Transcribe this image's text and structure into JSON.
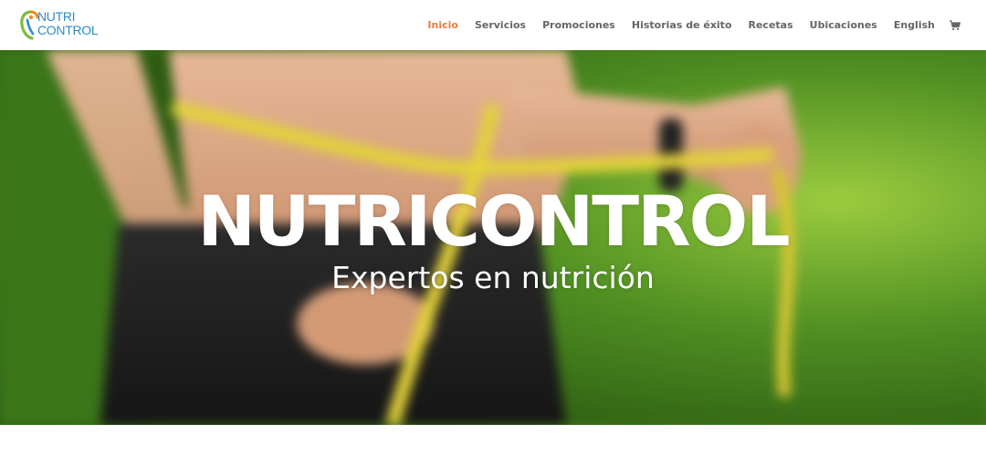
{
  "logo": {
    "line1": "NUTRI",
    "line2": "CONTROL"
  },
  "nav": {
    "items": [
      {
        "label": "Inicio"
      },
      {
        "label": "Servicios"
      },
      {
        "label": "Promociones"
      },
      {
        "label": "Historias de éxito"
      },
      {
        "label": "Recetas"
      },
      {
        "label": "Ubicaciones"
      },
      {
        "label": "English"
      }
    ],
    "cart_icon": "shopping-cart-icon"
  },
  "hero": {
    "title": "NUTRICONTROL",
    "subtitle": "Expertos en nutrición"
  },
  "colors": {
    "active_nav": "#e87c3e",
    "nav_text": "#666666",
    "logo_blue": "#2f8bc9",
    "logo_green": "#7bbf3a",
    "logo_orange": "#f08a24"
  }
}
